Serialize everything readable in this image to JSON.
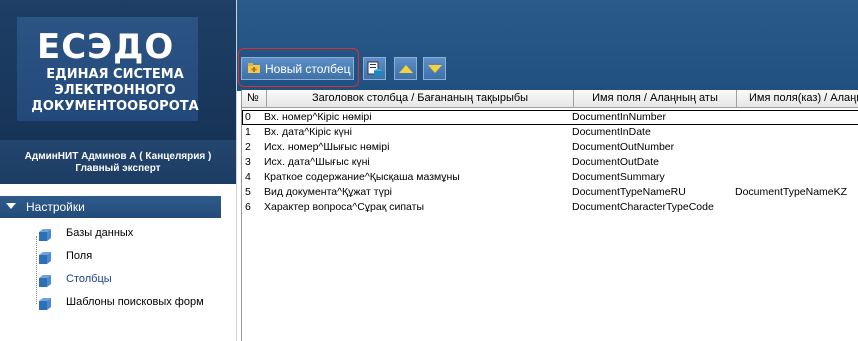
{
  "logo": {
    "title": "ЕСЭДО",
    "lines": [
      "ЕДИНАЯ СИСТЕМА",
      "ЭЛЕКТРОННОГО",
      "ДОКУМЕНТООБОРОТА"
    ]
  },
  "user": {
    "name": "АдминНИТ Админов А ( Канцелярия )",
    "role": "Главный эксперт"
  },
  "sidebar": {
    "section_label": "Настройки",
    "items": [
      {
        "label": "Базы данных"
      },
      {
        "label": "Поля"
      },
      {
        "label": "Столбцы"
      },
      {
        "label": "Шаблоны поисковых форм"
      }
    ]
  },
  "toolbar": {
    "new_column_label": "Новый столбец"
  },
  "grid": {
    "headers": [
      "№",
      "Заголовок столбца / Бағананың тақырыбы",
      "Имя поля / Алаңның аты",
      "Имя поля(каз) / Алаңн"
    ],
    "rows": [
      {
        "num": "0",
        "title": "Вх. номер^Кіріс нөмірі",
        "field": "DocumentInNumber",
        "field_kz": ""
      },
      {
        "num": "1",
        "title": "Вх. дата^Кіріс күні",
        "field": "DocumentInDate",
        "field_kz": ""
      },
      {
        "num": "2",
        "title": "Исх. номер^Шығыс нөмірі",
        "field": "DocumentOutNumber",
        "field_kz": ""
      },
      {
        "num": "3",
        "title": "Исх. дата^Шығыс күні",
        "field": "DocumentOutDate",
        "field_kz": ""
      },
      {
        "num": "4",
        "title": "Краткое содержание^Қысқаша мазмұны",
        "field": "DocumentSummary",
        "field_kz": ""
      },
      {
        "num": "5",
        "title": "Вид документа^Құжат түрі",
        "field": "DocumentTypeNameRU",
        "field_kz": "DocumentTypeNameKZ"
      },
      {
        "num": "6",
        "title": "Характер вопроса^Сұрақ сипаты",
        "field": "DocumentCharacterTypeCode",
        "field_kz": ""
      }
    ]
  },
  "colors": {
    "header_blue": "#1e3f66",
    "accent_yellow": "#f5d23a",
    "highlight_red": "#d83030"
  }
}
